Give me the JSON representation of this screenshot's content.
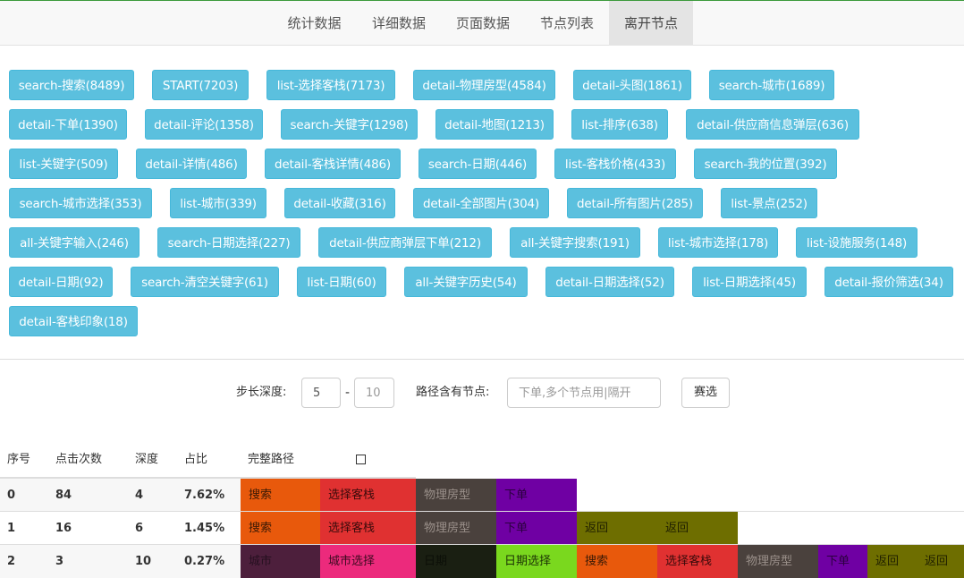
{
  "nav": {
    "tabs": [
      {
        "label": "统计数据",
        "active": false
      },
      {
        "label": "详细数据",
        "active": false
      },
      {
        "label": "页面数据",
        "active": false
      },
      {
        "label": "节点列表",
        "active": false
      },
      {
        "label": "离开节点",
        "active": true
      }
    ]
  },
  "tags": [
    "search-搜索(8489)",
    "START(7203)",
    "list-选择客栈(7173)",
    "detail-物理房型(4584)",
    "detail-头图(1861)",
    "search-城市(1689)",
    "detail-下单(1390)",
    "detail-评论(1358)",
    "search-关键字(1298)",
    "detail-地图(1213)",
    "list-排序(638)",
    "detail-供应商信息弹层(636)",
    "list-关键字(509)",
    "detail-详情(486)",
    "detail-客栈详情(486)",
    "search-日期(446)",
    "list-客栈价格(433)",
    "search-我的位置(392)",
    "search-城市选择(353)",
    "list-城市(339)",
    "detail-收藏(316)",
    "detail-全部图片(304)",
    "detail-所有图片(285)",
    "list-景点(252)",
    "all-关键字输入(246)",
    "search-日期选择(227)",
    "detail-供应商弹层下单(212)",
    "all-关键字搜索(191)",
    "list-城市选择(178)",
    "list-设施服务(148)",
    "detail-日期(92)",
    "search-清空关键字(61)",
    "list-日期(60)",
    "all-关键字历史(54)",
    "detail-日期选择(52)",
    "list-日期选择(45)",
    "detail-报价筛选(34)",
    "detail-客栈印象(18)"
  ],
  "filter": {
    "depth_label": "步长深度:",
    "depth_min": "5",
    "depth_sep": "-",
    "depth_max_placeholder": "10",
    "path_label": "路径含有节点:",
    "path_placeholder": "下单,多个节点用|隔开",
    "button_label": "赛选"
  },
  "table": {
    "headers": {
      "index": "序号",
      "clicks": "点击次数",
      "depth": "深度",
      "ratio": "占比",
      "path": "完整路径"
    },
    "select_all_checked": false,
    "rows": [
      {
        "index": "0",
        "clicks": "84",
        "depth": "4",
        "ratio": "7.62%",
        "path": [
          "搜索",
          "选择客栈",
          "物理房型",
          "下单"
        ]
      },
      {
        "index": "1",
        "clicks": "16",
        "depth": "6",
        "ratio": "1.45%",
        "path": [
          "搜索",
          "选择客栈",
          "物理房型",
          "下单",
          "返回",
          "返回"
        ]
      },
      {
        "index": "2",
        "clicks": "3",
        "depth": "10",
        "ratio": "0.27%",
        "path": [
          "城市",
          "城市选择",
          "日期",
          "日期选择",
          "搜索",
          "选择客栈",
          "物理房型",
          "下单",
          "返回",
          "返回"
        ]
      }
    ]
  },
  "colors": {
    "搜索": "#e8590c",
    "选择客栈": "#e03131",
    "物理房型": "#4a413d",
    "下单": "#6f00a3",
    "返回": "#6e6e00",
    "城市": "#4d1f3c",
    "城市选择": "#ec2a7c",
    "日期": "#1a1f12",
    "日期选择": "#7ad81e",
    "tag_bg": "#5bc0de",
    "row_stripe": "#f7f7f7"
  }
}
